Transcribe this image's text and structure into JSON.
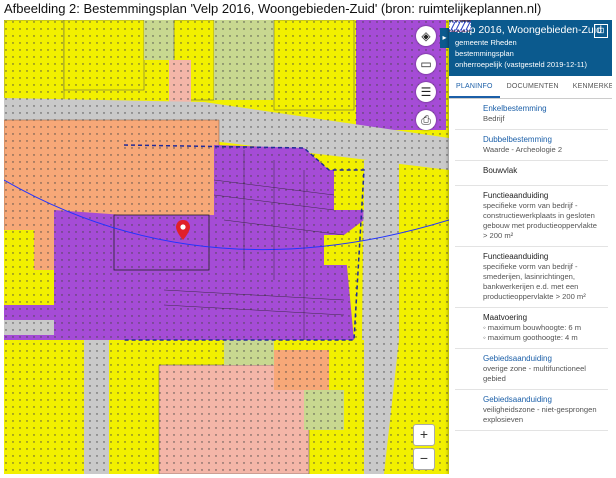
{
  "caption": "Afbeelding 2: Bestemmingsplan 'Velp 2016, Woongebieden-Zuid' (bron: ruimtelijkeplannen.nl)",
  "map": {
    "toolbar": [
      {
        "icon": "layers-icon"
      },
      {
        "icon": "ruler-icon"
      },
      {
        "icon": "list-icon"
      },
      {
        "icon": "print-icon"
      }
    ],
    "zoom_in": "+",
    "zoom_out": "−",
    "marker": {
      "icon": "location-pin-icon"
    }
  },
  "colors": {
    "wonen": "#f2f000",
    "bedrijf": "#a54cd6",
    "tuin": "#c8d890",
    "verkeer": "#c9c9c9",
    "centrum": "#f7a878",
    "maatschappelijk": "#f4b6a8",
    "panel_header": "#0b5a8e",
    "accent": "#1b5fa8"
  },
  "panel": {
    "title": "Velp 2016, Woongebieden-Zuid",
    "municipality": "gemeente Rheden",
    "type": "bestemmingsplan",
    "status": "onherroepelijk (vastgesteld 2019-12-11)",
    "expand_icon": "⊡",
    "collapse_icon": "▸",
    "tabs": [
      "PLANINFO",
      "DOCUMENTEN",
      "KENMERKEN"
    ],
    "legend": [
      {
        "title": "Enkelbestemming",
        "lines": [
          "Bedrijf"
        ],
        "symbol": "purple-parallelogram",
        "link": true
      },
      {
        "title": "Dubbelbestemming",
        "lines": [
          "Waarde - Archeologie 2"
        ],
        "symbol": "grey-dotted-box",
        "link": true
      },
      {
        "title": "Bouwvlak",
        "lines": [],
        "symbol": "bouwvlak-outline",
        "link": false
      },
      {
        "title": "Functieaanduiding",
        "lines": [
          "specifieke vorm van bedrijf -",
          "constructiewerkplaats in gesloten",
          "gebouw met productieoppervlakte",
          "> 200 m²"
        ],
        "symbol": "dashed-box",
        "link": false
      },
      {
        "title": "Functieaanduiding",
        "lines": [
          "specifieke vorm van bedrijf -",
          "smederijen, lasinrichtingen,",
          "bankwerkerijen e.d. met een",
          "productieoppervlakte > 200 m²"
        ],
        "symbol": "dashed-box",
        "link": false
      },
      {
        "title": "Maatvoering",
        "lines": [
          "◦ maximum bouwhoogte: 6 m",
          "◦ maximum goothoogte: 4 m"
        ],
        "symbol": "dashed-box",
        "link": false
      },
      {
        "title": "Gebiedsaanduiding",
        "lines": [
          "overige zone - multifunctioneel",
          "gebied"
        ],
        "symbol": "hatched-dark",
        "link": true
      },
      {
        "title": "Gebiedsaanduiding",
        "lines": [
          "veiligheidszone - niet-gesprongen",
          "explosieven"
        ],
        "symbol": "hatched-blue",
        "link": true
      }
    ]
  }
}
